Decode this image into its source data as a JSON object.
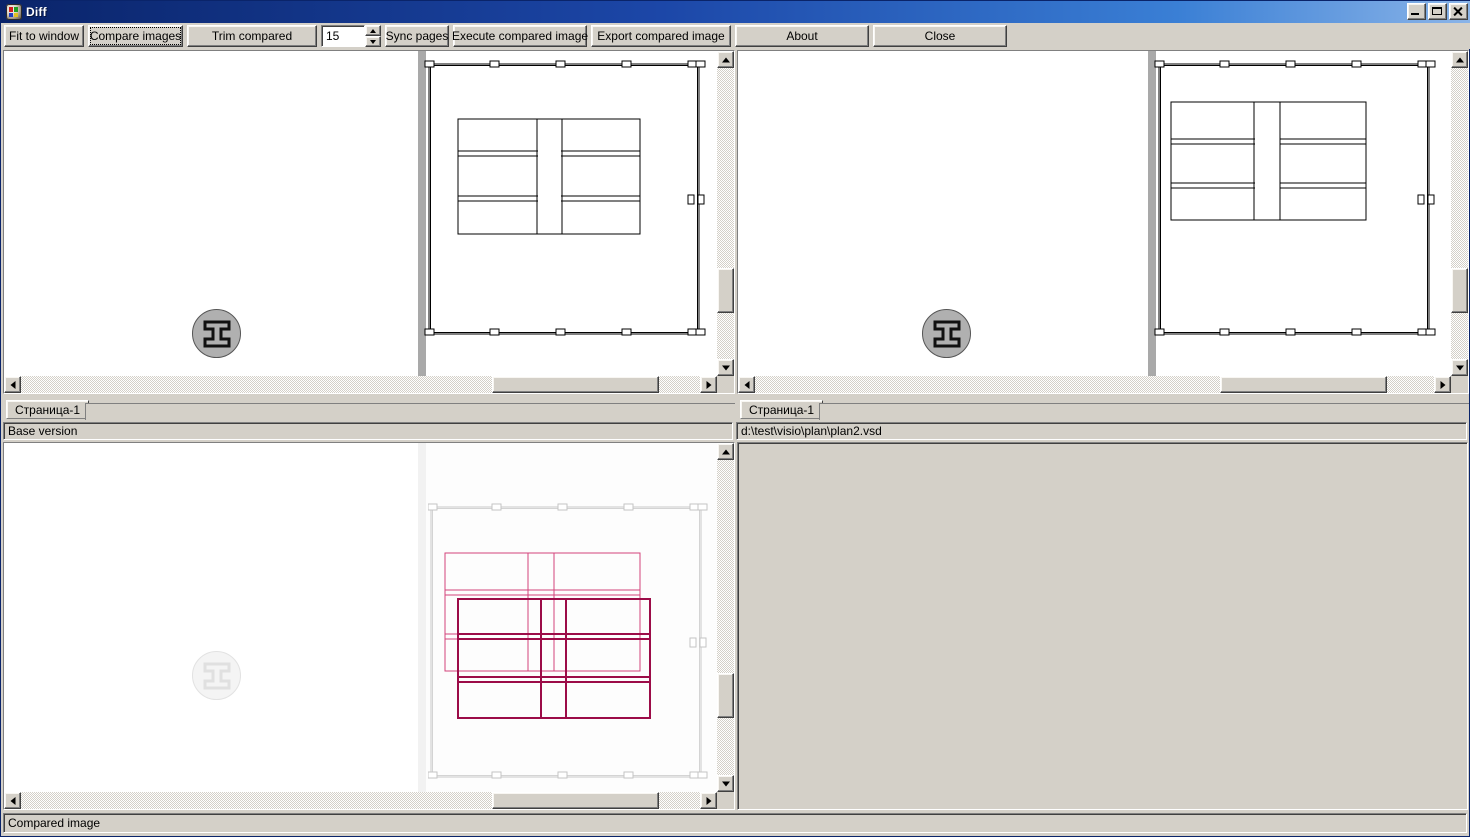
{
  "window": {
    "title": "Diff",
    "icon": "app-icon",
    "controls": {
      "minimize": "Minimize",
      "maximize": "Maximize",
      "close": "Close"
    }
  },
  "toolbar": {
    "fit_to_window": "Fit to window",
    "compare_images": "Compare images",
    "trim_compared": "Trim compared",
    "page_number_value": "15",
    "sync_pages": "Sync pages",
    "execute_compared_image": "Execute compared image",
    "export_compared_image": "Export compared image",
    "about": "About",
    "close": "Close"
  },
  "panels": {
    "base": {
      "tab_label": "Страница-1",
      "status": "Base version",
      "badge_icon": "ibeam-icon"
    },
    "modified": {
      "tab_label": "Страница-1",
      "status": "d:\\test\\visio\\plan\\plan2.vsd",
      "badge_icon": "ibeam-icon"
    },
    "compared": {
      "status": "Compared image",
      "badge_icon": "ibeam-icon"
    }
  },
  "colors": {
    "titlebar_start": "#0a246a",
    "titlebar_end": "#8ab4e8",
    "face": "#d4d0c8",
    "diff_old": "#d4447a",
    "diff_new": "#9c0c48",
    "drawing_line": "#000000"
  },
  "scrollbars": {
    "top_left_v_thumb_pct": 72,
    "top_left_h_thumb_pct": 68,
    "top_right_v_thumb_pct": 62,
    "top_right_h_thumb_pct": 66,
    "bottom_left_v_thumb_pct": 70,
    "bottom_left_h_thumb_pct": 68
  }
}
